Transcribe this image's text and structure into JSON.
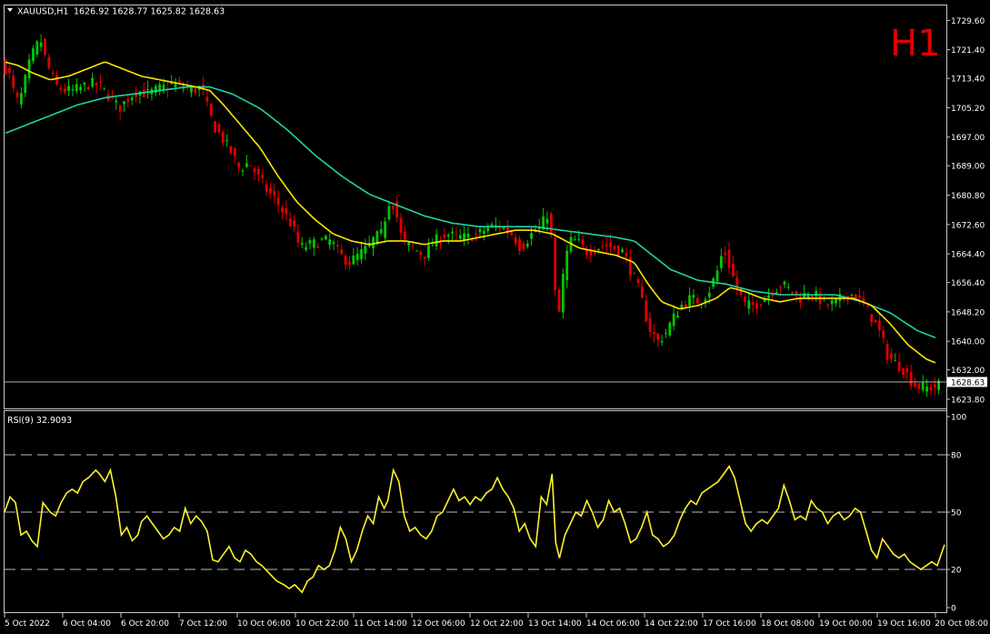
{
  "header": {
    "symbol": "XAUUSD,H1",
    "ohlc": "1626.92 1628.77 1625.82 1628.63",
    "timeframe_badge": "H1"
  },
  "price_panel": {
    "y_ticks": [
      "1729.60",
      "1721.40",
      "1713.40",
      "1705.20",
      "1697.00",
      "1689.00",
      "1680.80",
      "1672.60",
      "1664.40",
      "1656.40",
      "1648.20",
      "1640.00",
      "1632.00",
      "1623.80"
    ],
    "current_price": "1628.63"
  },
  "rsi_panel": {
    "label": "RSI(9) 32.9093",
    "y_ticks": [
      "100",
      "80",
      "50",
      "20",
      "0"
    ]
  },
  "x_axis": {
    "labels": [
      "5 Oct 2022",
      "6 Oct 04:00",
      "6 Oct 20:00",
      "7 Oct 12:00",
      "10 Oct 06:00",
      "10 Oct 22:00",
      "11 Oct 14:00",
      "12 Oct 06:00",
      "12 Oct 22:00",
      "13 Oct 14:00",
      "14 Oct 06:00",
      "14 Oct 22:00",
      "17 Oct 16:00",
      "18 Oct 08:00",
      "19 Oct 00:00",
      "19 Oct 16:00",
      "20 Oct 08:00"
    ]
  },
  "colors": {
    "background": "#000000",
    "bull": "#00C800",
    "bear": "#E00000",
    "ma_fast": "#FFE500",
    "ma_slow": "#1FD3A0",
    "rsi": "#FFF22E",
    "badge": "#E00000"
  },
  "chart_data": {
    "type": "candlestick",
    "price_range": [
      1621.5,
      1733.5
    ],
    "price_anchors": [
      [
        0,
        1718
      ],
      [
        6,
        1716
      ],
      [
        10,
        1714
      ],
      [
        14,
        1710
      ],
      [
        20,
        1706
      ],
      [
        26,
        1712
      ],
      [
        32,
        1718
      ],
      [
        38,
        1722
      ],
      [
        44,
        1724
      ],
      [
        50,
        1718
      ],
      [
        56,
        1714
      ],
      [
        62,
        1711
      ],
      [
        70,
        1710
      ],
      [
        80,
        1710
      ],
      [
        90,
        1711
      ],
      [
        100,
        1712
      ],
      [
        110,
        1711
      ],
      [
        120,
        1708
      ],
      [
        130,
        1705
      ],
      [
        140,
        1708
      ],
      [
        150,
        1710
      ],
      [
        160,
        1709
      ],
      [
        170,
        1710
      ],
      [
        180,
        1711
      ],
      [
        190,
        1712
      ],
      [
        200,
        1711
      ],
      [
        210,
        1710
      ],
      [
        220,
        1711
      ],
      [
        228,
        1704
      ],
      [
        234,
        1700
      ],
      [
        242,
        1697
      ],
      [
        252,
        1693
      ],
      [
        262,
        1688
      ],
      [
        272,
        1690
      ],
      [
        282,
        1686
      ],
      [
        292,
        1682
      ],
      [
        300,
        1680
      ],
      [
        310,
        1676
      ],
      [
        320,
        1672
      ],
      [
        328,
        1666
      ],
      [
        340,
        1667
      ],
      [
        352,
        1668
      ],
      [
        362,
        1668
      ],
      [
        372,
        1664
      ],
      [
        382,
        1662
      ],
      [
        392,
        1664
      ],
      [
        402,
        1666
      ],
      [
        410,
        1669
      ],
      [
        418,
        1670
      ],
      [
        424,
        1678
      ],
      [
        428,
        1680
      ],
      [
        434,
        1675
      ],
      [
        440,
        1668
      ],
      [
        452,
        1666
      ],
      [
        464,
        1664
      ],
      [
        476,
        1668
      ],
      [
        488,
        1670
      ],
      [
        500,
        1669
      ],
      [
        512,
        1669
      ],
      [
        524,
        1670
      ],
      [
        536,
        1672
      ],
      [
        548,
        1672
      ],
      [
        560,
        1670
      ],
      [
        570,
        1666
      ],
      [
        582,
        1670
      ],
      [
        592,
        1672
      ],
      [
        600,
        1676
      ],
      [
        604,
        1668
      ],
      [
        608,
        1652
      ],
      [
        612,
        1648
      ],
      [
        618,
        1662
      ],
      [
        624,
        1668
      ],
      [
        632,
        1668
      ],
      [
        642,
        1665
      ],
      [
        652,
        1666
      ],
      [
        662,
        1667
      ],
      [
        672,
        1666
      ],
      [
        682,
        1665
      ],
      [
        690,
        1660
      ],
      [
        700,
        1654
      ],
      [
        710,
        1644
      ],
      [
        720,
        1640
      ],
      [
        728,
        1642
      ],
      [
        736,
        1646
      ],
      [
        746,
        1650
      ],
      [
        756,
        1652
      ],
      [
        766,
        1651
      ],
      [
        776,
        1654
      ],
      [
        786,
        1660
      ],
      [
        792,
        1666
      ],
      [
        800,
        1660
      ],
      [
        808,
        1654
      ],
      [
        816,
        1650
      ],
      [
        826,
        1650
      ],
      [
        836,
        1652
      ],
      [
        846,
        1654
      ],
      [
        856,
        1656
      ],
      [
        866,
        1654
      ],
      [
        876,
        1652
      ],
      [
        886,
        1654
      ],
      [
        896,
        1652
      ],
      [
        906,
        1650
      ],
      [
        916,
        1651
      ],
      [
        926,
        1653
      ],
      [
        936,
        1653
      ],
      [
        946,
        1650
      ],
      [
        956,
        1646
      ],
      [
        964,
        1642
      ],
      [
        972,
        1636
      ],
      [
        980,
        1634
      ],
      [
        990,
        1632
      ],
      [
        1000,
        1628
      ],
      [
        1010,
        1627
      ],
      [
        1020,
        1627
      ],
      [
        1030,
        1628
      ]
    ],
    "ma_fast_anchors": [
      [
        0,
        1718
      ],
      [
        15,
        1717
      ],
      [
        30,
        1715
      ],
      [
        50,
        1713
      ],
      [
        70,
        1714
      ],
      [
        90,
        1716
      ],
      [
        110,
        1718
      ],
      [
        130,
        1716
      ],
      [
        150,
        1714
      ],
      [
        170,
        1713
      ],
      [
        190,
        1712
      ],
      [
        210,
        1711
      ],
      [
        225,
        1710
      ],
      [
        240,
        1706
      ],
      [
        260,
        1700
      ],
      [
        280,
        1694
      ],
      [
        300,
        1686
      ],
      [
        320,
        1679
      ],
      [
        340,
        1674
      ],
      [
        360,
        1670
      ],
      [
        380,
        1668
      ],
      [
        400,
        1667
      ],
      [
        420,
        1668
      ],
      [
        440,
        1668
      ],
      [
        460,
        1667
      ],
      [
        480,
        1668
      ],
      [
        500,
        1668
      ],
      [
        520,
        1669
      ],
      [
        540,
        1670
      ],
      [
        560,
        1671
      ],
      [
        580,
        1671
      ],
      [
        600,
        1670
      ],
      [
        615,
        1668
      ],
      [
        630,
        1666
      ],
      [
        650,
        1665
      ],
      [
        670,
        1664
      ],
      [
        690,
        1662
      ],
      [
        705,
        1656
      ],
      [
        720,
        1651
      ],
      [
        740,
        1649
      ],
      [
        760,
        1650
      ],
      [
        780,
        1652
      ],
      [
        795,
        1655
      ],
      [
        810,
        1654
      ],
      [
        830,
        1652
      ],
      [
        850,
        1651
      ],
      [
        870,
        1652
      ],
      [
        890,
        1652
      ],
      [
        910,
        1652
      ],
      [
        930,
        1652
      ],
      [
        950,
        1650
      ],
      [
        970,
        1645
      ],
      [
        990,
        1639
      ],
      [
        1010,
        1635
      ],
      [
        1030,
        1633
      ]
    ],
    "ma_slow_anchors": [
      [
        0,
        1698
      ],
      [
        20,
        1700
      ],
      [
        50,
        1703
      ],
      [
        80,
        1706
      ],
      [
        110,
        1708
      ],
      [
        140,
        1709
      ],
      [
        170,
        1710
      ],
      [
        200,
        1711
      ],
      [
        225,
        1711
      ],
      [
        250,
        1709
      ],
      [
        280,
        1705
      ],
      [
        310,
        1699
      ],
      [
        340,
        1692
      ],
      [
        370,
        1686
      ],
      [
        400,
        1681
      ],
      [
        430,
        1678
      ],
      [
        460,
        1675
      ],
      [
        490,
        1673
      ],
      [
        520,
        1672
      ],
      [
        550,
        1672
      ],
      [
        580,
        1672
      ],
      [
        610,
        1671
      ],
      [
        640,
        1670
      ],
      [
        670,
        1669
      ],
      [
        690,
        1668
      ],
      [
        710,
        1664
      ],
      [
        730,
        1660
      ],
      [
        760,
        1657
      ],
      [
        790,
        1656
      ],
      [
        820,
        1654
      ],
      [
        850,
        1653
      ],
      [
        880,
        1653
      ],
      [
        910,
        1653
      ],
      [
        940,
        1651
      ],
      [
        970,
        1648
      ],
      [
        1000,
        1643
      ],
      [
        1030,
        1640
      ]
    ],
    "rsi_range": [
      0,
      100
    ],
    "rsi_levels": [
      80,
      50,
      20
    ],
    "rsi_values": [
      [
        0,
        50
      ],
      [
        6,
        58
      ],
      [
        12,
        55
      ],
      [
        18,
        38
      ],
      [
        24,
        40
      ],
      [
        30,
        35
      ],
      [
        36,
        32
      ],
      [
        42,
        55
      ],
      [
        50,
        50
      ],
      [
        56,
        48
      ],
      [
        62,
        55
      ],
      [
        68,
        60
      ],
      [
        74,
        62
      ],
      [
        80,
        60
      ],
      [
        86,
        66
      ],
      [
        92,
        68
      ],
      [
        100,
        72
      ],
      [
        104,
        70
      ],
      [
        110,
        66
      ],
      [
        116,
        72
      ],
      [
        122,
        58
      ],
      [
        128,
        38
      ],
      [
        134,
        42
      ],
      [
        140,
        35
      ],
      [
        146,
        38
      ],
      [
        150,
        45
      ],
      [
        156,
        48
      ],
      [
        162,
        44
      ],
      [
        168,
        40
      ],
      [
        174,
        36
      ],
      [
        180,
        38
      ],
      [
        186,
        42
      ],
      [
        192,
        40
      ],
      [
        198,
        52
      ],
      [
        204,
        44
      ],
      [
        210,
        48
      ],
      [
        216,
        45
      ],
      [
        222,
        40
      ],
      [
        228,
        25
      ],
      [
        234,
        24
      ],
      [
        240,
        28
      ],
      [
        246,
        32
      ],
      [
        252,
        26
      ],
      [
        258,
        24
      ],
      [
        264,
        30
      ],
      [
        270,
        28
      ],
      [
        276,
        24
      ],
      [
        282,
        22
      ],
      [
        290,
        18
      ],
      [
        298,
        14
      ],
      [
        306,
        12
      ],
      [
        312,
        10
      ],
      [
        318,
        12
      ],
      [
        326,
        8
      ],
      [
        332,
        14
      ],
      [
        338,
        16
      ],
      [
        344,
        22
      ],
      [
        350,
        20
      ],
      [
        356,
        22
      ],
      [
        362,
        30
      ],
      [
        368,
        42
      ],
      [
        374,
        36
      ],
      [
        380,
        24
      ],
      [
        386,
        30
      ],
      [
        392,
        40
      ],
      [
        398,
        48
      ],
      [
        404,
        44
      ],
      [
        410,
        58
      ],
      [
        416,
        52
      ],
      [
        420,
        56
      ],
      [
        426,
        72
      ],
      [
        432,
        66
      ],
      [
        438,
        48
      ],
      [
        444,
        40
      ],
      [
        450,
        42
      ],
      [
        456,
        38
      ],
      [
        462,
        36
      ],
      [
        468,
        40
      ],
      [
        474,
        48
      ],
      [
        480,
        50
      ],
      [
        486,
        56
      ],
      [
        492,
        62
      ],
      [
        498,
        56
      ],
      [
        504,
        58
      ],
      [
        510,
        54
      ],
      [
        516,
        58
      ],
      [
        522,
        56
      ],
      [
        528,
        60
      ],
      [
        534,
        62
      ],
      [
        540,
        68
      ],
      [
        546,
        62
      ],
      [
        552,
        58
      ],
      [
        558,
        52
      ],
      [
        564,
        40
      ],
      [
        570,
        44
      ],
      [
        576,
        36
      ],
      [
        582,
        32
      ],
      [
        588,
        58
      ],
      [
        594,
        54
      ],
      [
        600,
        70
      ],
      [
        604,
        34
      ],
      [
        608,
        26
      ],
      [
        614,
        38
      ],
      [
        620,
        44
      ],
      [
        626,
        50
      ],
      [
        632,
        48
      ],
      [
        638,
        56
      ],
      [
        644,
        50
      ],
      [
        650,
        42
      ],
      [
        656,
        46
      ],
      [
        662,
        56
      ],
      [
        668,
        50
      ],
      [
        674,
        52
      ],
      [
        680,
        44
      ],
      [
        686,
        34
      ],
      [
        692,
        36
      ],
      [
        698,
        42
      ],
      [
        704,
        50
      ],
      [
        710,
        38
      ],
      [
        716,
        36
      ],
      [
        722,
        32
      ],
      [
        728,
        34
      ],
      [
        734,
        38
      ],
      [
        740,
        46
      ],
      [
        746,
        52
      ],
      [
        752,
        56
      ],
      [
        758,
        54
      ],
      [
        764,
        60
      ],
      [
        770,
        62
      ],
      [
        776,
        64
      ],
      [
        782,
        66
      ],
      [
        788,
        70
      ],
      [
        794,
        74
      ],
      [
        800,
        68
      ],
      [
        806,
        56
      ],
      [
        812,
        44
      ],
      [
        818,
        40
      ],
      [
        824,
        44
      ],
      [
        830,
        46
      ],
      [
        836,
        44
      ],
      [
        842,
        48
      ],
      [
        848,
        52
      ],
      [
        854,
        64
      ],
      [
        860,
        56
      ],
      [
        866,
        46
      ],
      [
        872,
        48
      ],
      [
        878,
        46
      ],
      [
        884,
        56
      ],
      [
        890,
        52
      ],
      [
        896,
        50
      ],
      [
        902,
        44
      ],
      [
        908,
        48
      ],
      [
        914,
        50
      ],
      [
        920,
        46
      ],
      [
        926,
        48
      ],
      [
        932,
        52
      ],
      [
        938,
        50
      ],
      [
        944,
        40
      ],
      [
        950,
        30
      ],
      [
        956,
        26
      ],
      [
        962,
        36
      ],
      [
        968,
        32
      ],
      [
        974,
        28
      ],
      [
        980,
        26
      ],
      [
        986,
        28
      ],
      [
        992,
        24
      ],
      [
        998,
        22
      ],
      [
        1004,
        20
      ],
      [
        1010,
        22
      ],
      [
        1016,
        24
      ],
      [
        1022,
        22
      ],
      [
        1030,
        33
      ]
    ]
  }
}
